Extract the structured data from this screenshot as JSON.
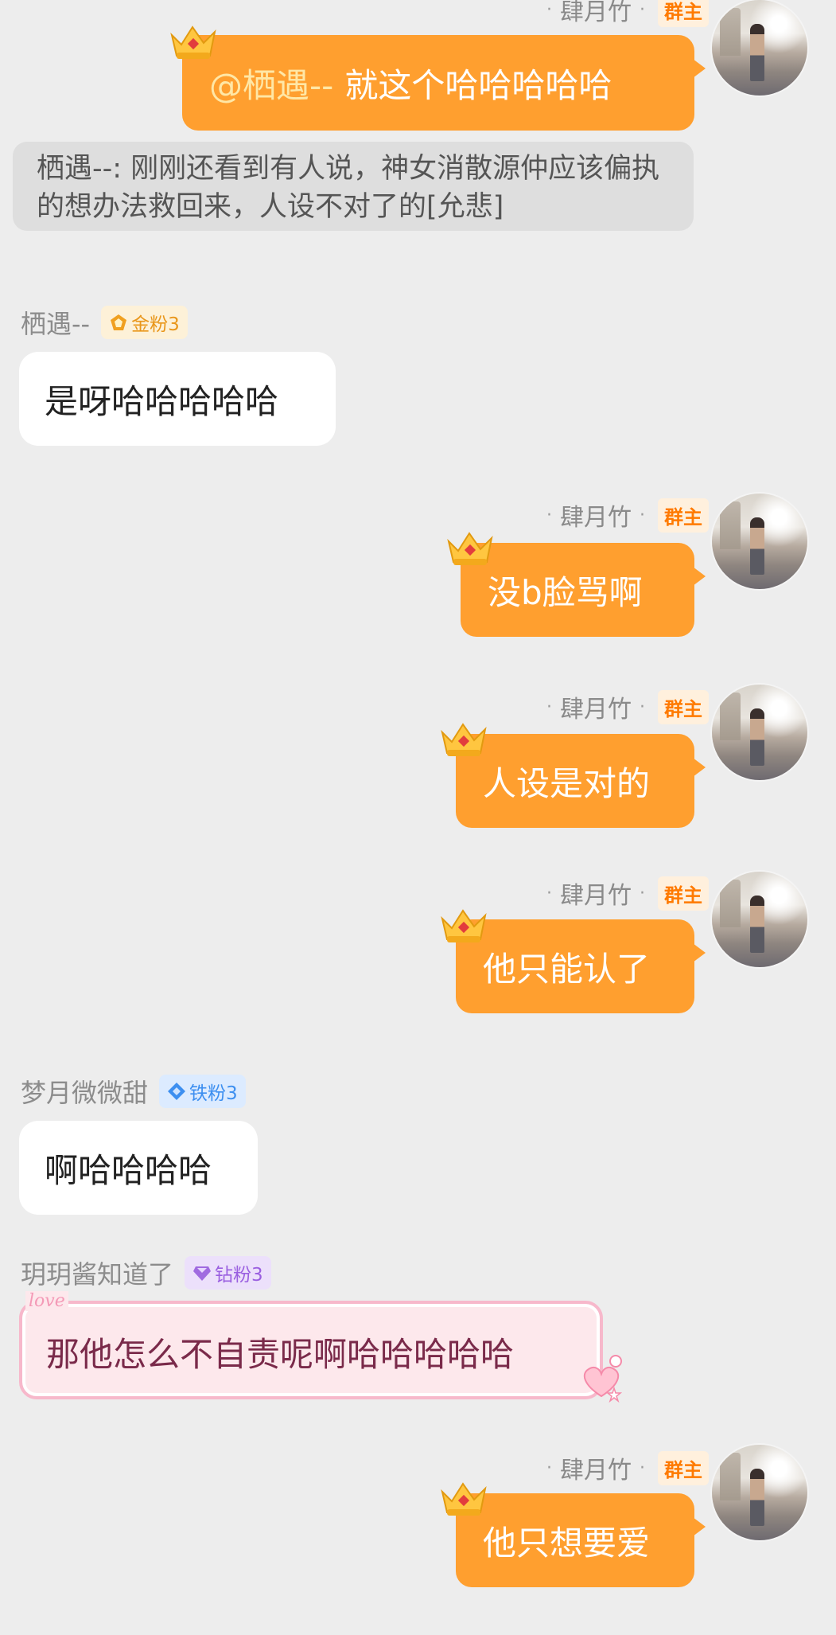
{
  "messages": {
    "m1": {
      "sender": "肆月竹",
      "role_badge": "群主",
      "mention": "@栖遇--",
      "text": "就这个哈哈哈哈哈",
      "quote": "栖遇--: 刚刚还看到有人说，神女消散源仲应该偏执的想办法救回来，人设不对了的[允悲]"
    },
    "m2": {
      "sender": "栖遇--",
      "fan_badge": "金粉3",
      "text": "是呀哈哈哈哈哈"
    },
    "m3": {
      "sender": "肆月竹",
      "role_badge": "群主",
      "text": "没b脸骂啊"
    },
    "m4": {
      "sender": "肆月竹",
      "role_badge": "群主",
      "text": "人设是对的"
    },
    "m5": {
      "sender": "肆月竹",
      "role_badge": "群主",
      "text": "他只能认了"
    },
    "m6": {
      "sender": "梦月微微甜",
      "fan_badge": "铁粉3",
      "text": "啊哈哈哈哈"
    },
    "m7": {
      "sender": "玥玥酱知道了",
      "fan_badge": "钻粉3",
      "text": "那他怎么不自责呢啊哈哈哈哈哈",
      "bubble_tag": "love"
    },
    "m8": {
      "sender": "肆月竹",
      "role_badge": "群主",
      "text": "他只想要爱"
    }
  },
  "colors": {
    "owner_bubble": "#ff9f2f",
    "owner_badge_text": "#ff7a00",
    "gold_fan": "#f0a020",
    "iron_fan": "#3d8ff0",
    "diamond_fan": "#a06be0",
    "love_bubble_text": "#7a2a4a"
  },
  "icons": {
    "crown": "crown-icon",
    "avatar": "user-avatar",
    "gold_fan": "gold-fan-badge-icon",
    "iron_fan": "iron-fan-badge-icon",
    "diamond_fan": "diamond-fan-badge-icon"
  }
}
